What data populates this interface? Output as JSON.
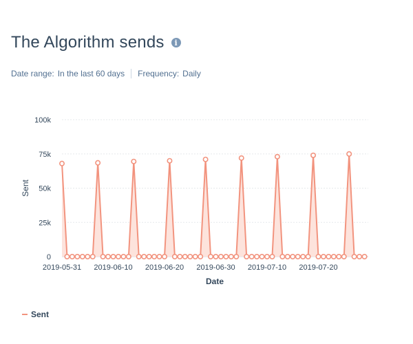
{
  "header": {
    "title": "The Algorithm sends",
    "info_icon": "info-icon"
  },
  "filters": {
    "date_range_label": "Date range:",
    "date_range_value": "In the last 60 days",
    "frequency_label": "Frequency:",
    "frequency_value": "Daily"
  },
  "colors": {
    "line": "#f2937e",
    "fill": "#fde3dc",
    "grid": "#e5e8eb",
    "axis_text": "#33475b"
  },
  "chart_data": {
    "type": "area",
    "xlabel": "Date",
    "ylabel": "Sent",
    "ylim": [
      0,
      100000
    ],
    "yticks": [
      0,
      25000,
      50000,
      75000,
      100000
    ],
    "ytick_labels": [
      "0",
      "25k",
      "50k",
      "75k",
      "100k"
    ],
    "xtick_labels": [
      "2019-05-31",
      "2019-06-10",
      "2019-06-20",
      "2019-06-30",
      "2019-07-10",
      "2019-07-20"
    ],
    "x_start": "2019-05-31",
    "grid": true,
    "legend": "bottom-left",
    "series": [
      {
        "name": "Sent",
        "x": [
          "2019-05-31",
          "2019-06-01",
          "2019-06-02",
          "2019-06-03",
          "2019-06-04",
          "2019-06-05",
          "2019-06-06",
          "2019-06-07",
          "2019-06-08",
          "2019-06-09",
          "2019-06-10",
          "2019-06-11",
          "2019-06-12",
          "2019-06-13",
          "2019-06-14",
          "2019-06-15",
          "2019-06-16",
          "2019-06-17",
          "2019-06-18",
          "2019-06-19",
          "2019-06-20",
          "2019-06-21",
          "2019-06-22",
          "2019-06-23",
          "2019-06-24",
          "2019-06-25",
          "2019-06-26",
          "2019-06-27",
          "2019-06-28",
          "2019-06-29",
          "2019-06-30",
          "2019-07-01",
          "2019-07-02",
          "2019-07-03",
          "2019-07-04",
          "2019-07-05",
          "2019-07-06",
          "2019-07-07",
          "2019-07-08",
          "2019-07-09",
          "2019-07-10",
          "2019-07-11",
          "2019-07-12",
          "2019-07-13",
          "2019-07-14",
          "2019-07-15",
          "2019-07-16",
          "2019-07-17",
          "2019-07-18",
          "2019-07-19",
          "2019-07-20",
          "2019-07-21",
          "2019-07-22",
          "2019-07-23",
          "2019-07-24",
          "2019-07-25",
          "2019-07-26",
          "2019-07-27",
          "2019-07-28",
          "2019-07-29"
        ],
        "values": [
          68000,
          0,
          0,
          0,
          0,
          0,
          0,
          68500,
          0,
          0,
          0,
          0,
          0,
          0,
          69500,
          0,
          0,
          0,
          0,
          0,
          0,
          70000,
          0,
          0,
          0,
          0,
          0,
          0,
          71000,
          0,
          0,
          0,
          0,
          0,
          0,
          72000,
          0,
          0,
          0,
          0,
          0,
          0,
          73000,
          0,
          0,
          0,
          0,
          0,
          0,
          74000,
          0,
          0,
          0,
          0,
          0,
          0,
          75000,
          0,
          0,
          0
        ]
      }
    ]
  }
}
